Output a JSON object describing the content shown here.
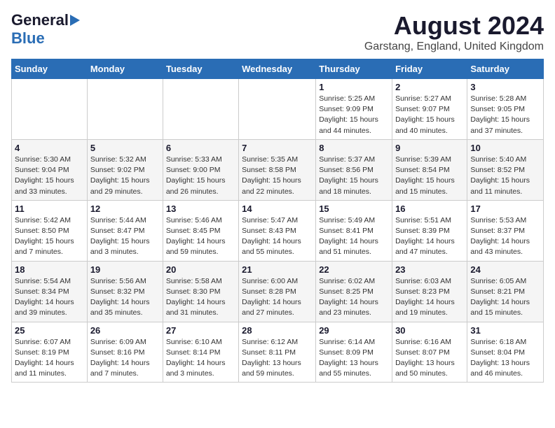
{
  "header": {
    "logo_general": "General",
    "logo_blue": "Blue",
    "month_year": "August 2024",
    "location": "Garstang, England, United Kingdom"
  },
  "days_of_week": [
    "Sunday",
    "Monday",
    "Tuesday",
    "Wednesday",
    "Thursday",
    "Friday",
    "Saturday"
  ],
  "weeks": [
    [
      {
        "day": "",
        "info": ""
      },
      {
        "day": "",
        "info": ""
      },
      {
        "day": "",
        "info": ""
      },
      {
        "day": "",
        "info": ""
      },
      {
        "day": "1",
        "info": "Sunrise: 5:25 AM\nSunset: 9:09 PM\nDaylight: 15 hours\nand 44 minutes."
      },
      {
        "day": "2",
        "info": "Sunrise: 5:27 AM\nSunset: 9:07 PM\nDaylight: 15 hours\nand 40 minutes."
      },
      {
        "day": "3",
        "info": "Sunrise: 5:28 AM\nSunset: 9:05 PM\nDaylight: 15 hours\nand 37 minutes."
      }
    ],
    [
      {
        "day": "4",
        "info": "Sunrise: 5:30 AM\nSunset: 9:04 PM\nDaylight: 15 hours\nand 33 minutes."
      },
      {
        "day": "5",
        "info": "Sunrise: 5:32 AM\nSunset: 9:02 PM\nDaylight: 15 hours\nand 29 minutes."
      },
      {
        "day": "6",
        "info": "Sunrise: 5:33 AM\nSunset: 9:00 PM\nDaylight: 15 hours\nand 26 minutes."
      },
      {
        "day": "7",
        "info": "Sunrise: 5:35 AM\nSunset: 8:58 PM\nDaylight: 15 hours\nand 22 minutes."
      },
      {
        "day": "8",
        "info": "Sunrise: 5:37 AM\nSunset: 8:56 PM\nDaylight: 15 hours\nand 18 minutes."
      },
      {
        "day": "9",
        "info": "Sunrise: 5:39 AM\nSunset: 8:54 PM\nDaylight: 15 hours\nand 15 minutes."
      },
      {
        "day": "10",
        "info": "Sunrise: 5:40 AM\nSunset: 8:52 PM\nDaylight: 15 hours\nand 11 minutes."
      }
    ],
    [
      {
        "day": "11",
        "info": "Sunrise: 5:42 AM\nSunset: 8:50 PM\nDaylight: 15 hours\nand 7 minutes."
      },
      {
        "day": "12",
        "info": "Sunrise: 5:44 AM\nSunset: 8:47 PM\nDaylight: 15 hours\nand 3 minutes."
      },
      {
        "day": "13",
        "info": "Sunrise: 5:46 AM\nSunset: 8:45 PM\nDaylight: 14 hours\nand 59 minutes."
      },
      {
        "day": "14",
        "info": "Sunrise: 5:47 AM\nSunset: 8:43 PM\nDaylight: 14 hours\nand 55 minutes."
      },
      {
        "day": "15",
        "info": "Sunrise: 5:49 AM\nSunset: 8:41 PM\nDaylight: 14 hours\nand 51 minutes."
      },
      {
        "day": "16",
        "info": "Sunrise: 5:51 AM\nSunset: 8:39 PM\nDaylight: 14 hours\nand 47 minutes."
      },
      {
        "day": "17",
        "info": "Sunrise: 5:53 AM\nSunset: 8:37 PM\nDaylight: 14 hours\nand 43 minutes."
      }
    ],
    [
      {
        "day": "18",
        "info": "Sunrise: 5:54 AM\nSunset: 8:34 PM\nDaylight: 14 hours\nand 39 minutes."
      },
      {
        "day": "19",
        "info": "Sunrise: 5:56 AM\nSunset: 8:32 PM\nDaylight: 14 hours\nand 35 minutes."
      },
      {
        "day": "20",
        "info": "Sunrise: 5:58 AM\nSunset: 8:30 PM\nDaylight: 14 hours\nand 31 minutes."
      },
      {
        "day": "21",
        "info": "Sunrise: 6:00 AM\nSunset: 8:28 PM\nDaylight: 14 hours\nand 27 minutes."
      },
      {
        "day": "22",
        "info": "Sunrise: 6:02 AM\nSunset: 8:25 PM\nDaylight: 14 hours\nand 23 minutes."
      },
      {
        "day": "23",
        "info": "Sunrise: 6:03 AM\nSunset: 8:23 PM\nDaylight: 14 hours\nand 19 minutes."
      },
      {
        "day": "24",
        "info": "Sunrise: 6:05 AM\nSunset: 8:21 PM\nDaylight: 14 hours\nand 15 minutes."
      }
    ],
    [
      {
        "day": "25",
        "info": "Sunrise: 6:07 AM\nSunset: 8:19 PM\nDaylight: 14 hours\nand 11 minutes."
      },
      {
        "day": "26",
        "info": "Sunrise: 6:09 AM\nSunset: 8:16 PM\nDaylight: 14 hours\nand 7 minutes."
      },
      {
        "day": "27",
        "info": "Sunrise: 6:10 AM\nSunset: 8:14 PM\nDaylight: 14 hours\nand 3 minutes."
      },
      {
        "day": "28",
        "info": "Sunrise: 6:12 AM\nSunset: 8:11 PM\nDaylight: 13 hours\nand 59 minutes."
      },
      {
        "day": "29",
        "info": "Sunrise: 6:14 AM\nSunset: 8:09 PM\nDaylight: 13 hours\nand 55 minutes."
      },
      {
        "day": "30",
        "info": "Sunrise: 6:16 AM\nSunset: 8:07 PM\nDaylight: 13 hours\nand 50 minutes."
      },
      {
        "day": "31",
        "info": "Sunrise: 6:18 AM\nSunset: 8:04 PM\nDaylight: 13 hours\nand 46 minutes."
      }
    ]
  ]
}
